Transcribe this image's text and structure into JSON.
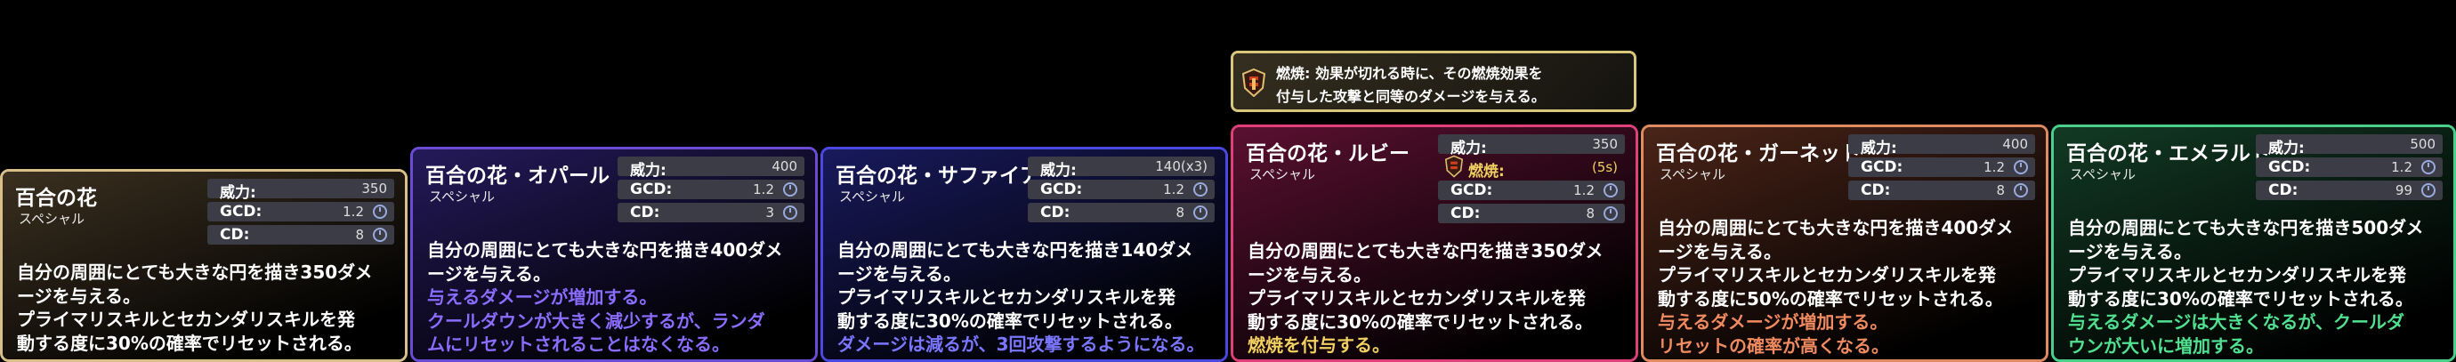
{
  "labels": {
    "power": "威力:",
    "gcd": "GCD:",
    "cd": "CD:"
  },
  "tooltip": {
    "icon": "burn-shield-icon",
    "lines": [
      "燃焼: 効果が切れる時に、その燃焼効果を",
      "付与した攻撃と同等のダメージを与える。"
    ]
  },
  "cards": [
    {
      "id": "base",
      "title": "百合の花",
      "subtitle": "スペシャル",
      "power": "350",
      "gcd": "1.2",
      "cd": "8",
      "border": "#d9c08a",
      "tint": "#3b3020",
      "desc": [
        "自分の周囲にとても大きな円を描き350ダメ",
        "ージを与える。",
        "プライマリスキルとセカンダリスキルを発",
        "動する度に30%の確率でリセットされる。"
      ],
      "emph_color": "#ffffff",
      "emph": []
    },
    {
      "id": "opal",
      "title": "百合の花・オパール",
      "subtitle": "スペシャル",
      "power": "400",
      "gcd": "1.2",
      "cd": "3",
      "border": "#6a4cd4",
      "tint": "#241a5a",
      "desc": [
        "自分の周囲にとても大きな円を描き400ダメ",
        "ージを与える。"
      ],
      "emph_color": "#8a6cff",
      "emph": [
        "与えるダメージが増加する。",
        "クールダウンが大きく減少するが、ランダ",
        "ムにリセットされることはなくなる。"
      ]
    },
    {
      "id": "sapphire",
      "title": "百合の花・サファイア",
      "subtitle": "スペシャル",
      "power": "140(x3)",
      "gcd": "1.2",
      "cd": "8",
      "border": "#4a48e0",
      "tint": "#181a5c",
      "desc": [
        "自分の周囲にとても大きな円を描き140ダメ",
        "ージを与える。",
        "プライマリスキルとセカンダリスキルを発",
        "動する度に30%の確率でリセットされる。"
      ],
      "emph_color": "#7a76ff",
      "emph": [
        "ダメージは減るが、3回攻撃するようになる。"
      ]
    },
    {
      "id": "ruby",
      "title": "百合の花・ルビー",
      "subtitle": "スペシャル",
      "power": "350",
      "burn_label": "燃焼:",
      "burn": "(5s)",
      "gcd": "1.2",
      "cd": "8",
      "border": "#e0407a",
      "tint": "#5a1030",
      "desc": [
        "自分の周囲にとても大きな円を描き350ダメ",
        "ージを与える。",
        "プライマリスキルとセカンダリスキルを発",
        "動する度に30%の確率でリセットされる。"
      ],
      "emph_color": "#f0d060",
      "emph": [
        "燃焼を付与する。"
      ]
    },
    {
      "id": "garnet",
      "title": "百合の花・ガーネット",
      "subtitle": "スペシャル",
      "power": "400",
      "gcd": "1.2",
      "cd": "8",
      "border": "#e08a60",
      "tint": "#4a2418",
      "desc": [
        "自分の周囲にとても大きな円を描き400ダメ",
        "ージを与える。",
        "プライマリスキルとセカンダリスキルを発",
        "動する度に50%の確率でリセットされる。"
      ],
      "emph_color": "#f08a60",
      "emph": [
        "与えるダメージが増加する。",
        "リセットの確率が高くなる。"
      ]
    },
    {
      "id": "emerald",
      "title": "百合の花・エメラルド",
      "subtitle": "スペシャル",
      "power": "500",
      "gcd": "1.2",
      "cd": "99",
      "border": "#4ad08a",
      "tint": "#123a24",
      "desc": [
        "自分の周囲にとても大きな円を描き500ダメ",
        "ージを与える。",
        "プライマリスキルとセカンダリスキルを発",
        "動する度に30%の確率でリセットされる。"
      ],
      "emph_color": "#50e090",
      "emph": [
        "与えるダメージは大きくなるが、クールダ",
        "ウンが大いに増加する。"
      ]
    }
  ]
}
